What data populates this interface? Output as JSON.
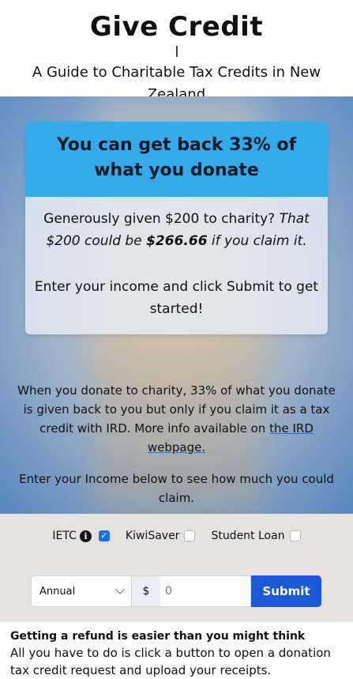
{
  "header": {
    "title": "Give Credit",
    "subtitle": "A Guide to Charitable Tax Credits in New Zealand"
  },
  "card": {
    "heading": "You can get back 33% of what you donate",
    "line1_plain": "Generously given $200 to charity? ",
    "line1_italic": "That $200 could be ",
    "line1_bold": "$266.66",
    "line1_tail": " if you claim it.",
    "line2": "Enter your income and click Submit to get started!"
  },
  "info": {
    "para1": "When you donate to charity, 33% of what you donate is given back to you but only if you claim it as a tax credit with IRD. More info available on ",
    "link": "the IRD webpage.",
    "para2": "Enter your Income below to see how much you could claim."
  },
  "options": {
    "ietc_label": "IETC",
    "ietc_checked": true,
    "kiwisaver_label": "KiwiSaver",
    "kiwisaver_checked": false,
    "student_loan_label": "Student Loan",
    "student_loan_checked": false,
    "info_glyph": "i"
  },
  "form": {
    "period": "Annual",
    "currency": "$",
    "amount_placeholder": "0",
    "submit_label": "Submit"
  },
  "footer": {
    "heading": "Getting a refund is easier than you might think",
    "text": "All you have to do is click a button to open a donation tax credit request and upload your receipts."
  },
  "colors": {
    "card_header": "#34abe8",
    "submit_button": "#1b59d9",
    "checkbox_checked": "#1e6fe6"
  }
}
